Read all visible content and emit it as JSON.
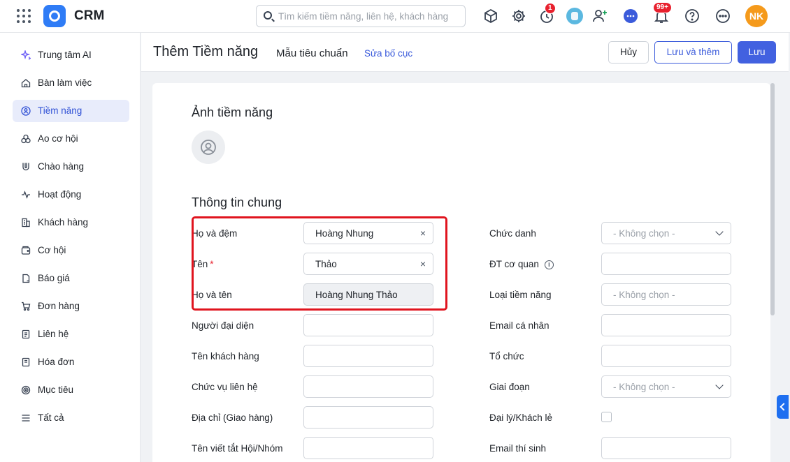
{
  "app": {
    "title": "CRM"
  },
  "search": {
    "placeholder": "Tìm kiếm tiềm năng, liên hệ, khách hàng"
  },
  "topbar": {
    "icons": [
      "product-box-icon",
      "gear-icon",
      "timer-icon",
      "bot-avatar",
      "add-user-icon",
      "chat-icon",
      "bell-icon",
      "help-icon",
      "more-icon"
    ],
    "timer_badge": "1",
    "bell_badge": "99+",
    "user_initials": "NK"
  },
  "sidebar": {
    "items": [
      {
        "label": "Trung tâm AI",
        "icon": "sparkle-icon"
      },
      {
        "label": "Bàn làm việc",
        "icon": "home-icon"
      },
      {
        "label": "Tiềm năng",
        "icon": "lead-icon",
        "active": true
      },
      {
        "label": "Ao cơ hội",
        "icon": "pool-icon"
      },
      {
        "label": "Chào hàng",
        "icon": "magnet-icon"
      },
      {
        "label": "Hoạt động",
        "icon": "activity-icon"
      },
      {
        "label": "Khách hàng",
        "icon": "building-icon"
      },
      {
        "label": "Cơ hội",
        "icon": "wallet-icon"
      },
      {
        "label": "Báo giá",
        "icon": "quote-icon"
      },
      {
        "label": "Đơn hàng",
        "icon": "cart-icon"
      },
      {
        "label": "Liên hệ",
        "icon": "contact-icon"
      },
      {
        "label": "Hóa đơn",
        "icon": "invoice-icon"
      },
      {
        "label": "Mục tiêu",
        "icon": "target-icon"
      },
      {
        "label": "Tất cả",
        "icon": "menu-icon"
      }
    ]
  },
  "header": {
    "title": "Thêm Tiềm năng",
    "layout_name": "Mẫu tiêu chuẩn",
    "edit_layout": "Sửa bố cục",
    "cancel_label": "Hủy",
    "save_add_label": "Lưu và thêm",
    "save_label": "Lưu"
  },
  "form": {
    "photo_section": "Ảnh tiềm năng",
    "general_section": "Thông tin chung",
    "left_fields": [
      {
        "label": "Họ và đệm",
        "value": "Hoàng Nhung",
        "clearable": true
      },
      {
        "label": "Tên",
        "value": "Thảo",
        "required": true,
        "clearable": true
      },
      {
        "label": "Họ và tên",
        "value": "Hoàng Nhung Thảo",
        "readonly": true
      },
      {
        "label": "Người đại diện",
        "value": ""
      },
      {
        "label": "Tên khách hàng",
        "value": ""
      },
      {
        "label": "Chức vụ liên hệ",
        "value": ""
      },
      {
        "label": "Địa chỉ (Giao hàng)",
        "value": ""
      },
      {
        "label": "Tên viết tắt Hội/Nhóm",
        "value": ""
      }
    ],
    "right_fields": [
      {
        "label": "Chức danh",
        "type": "select",
        "placeholder": "- Không chọn -"
      },
      {
        "label": "ĐT cơ quan",
        "type": "text",
        "info": true
      },
      {
        "label": "Loại tiềm năng",
        "type": "select-no-arrow",
        "placeholder": "- Không chọn -"
      },
      {
        "label": "Email cá nhân",
        "type": "text"
      },
      {
        "label": "Tổ chức",
        "type": "text"
      },
      {
        "label": "Giai đoạn",
        "type": "select",
        "placeholder": "- Không chọn -"
      },
      {
        "label": "Đại lý/Khách lẻ",
        "type": "checkbox"
      },
      {
        "label": "Email thí sinh",
        "type": "text"
      }
    ],
    "info_glyph": "i",
    "clear_glyph": "×",
    "required_mark": "*"
  },
  "colors": {
    "accent": "#4261e0",
    "highlight": "#e0141e",
    "avatar": "#f59a1b"
  }
}
